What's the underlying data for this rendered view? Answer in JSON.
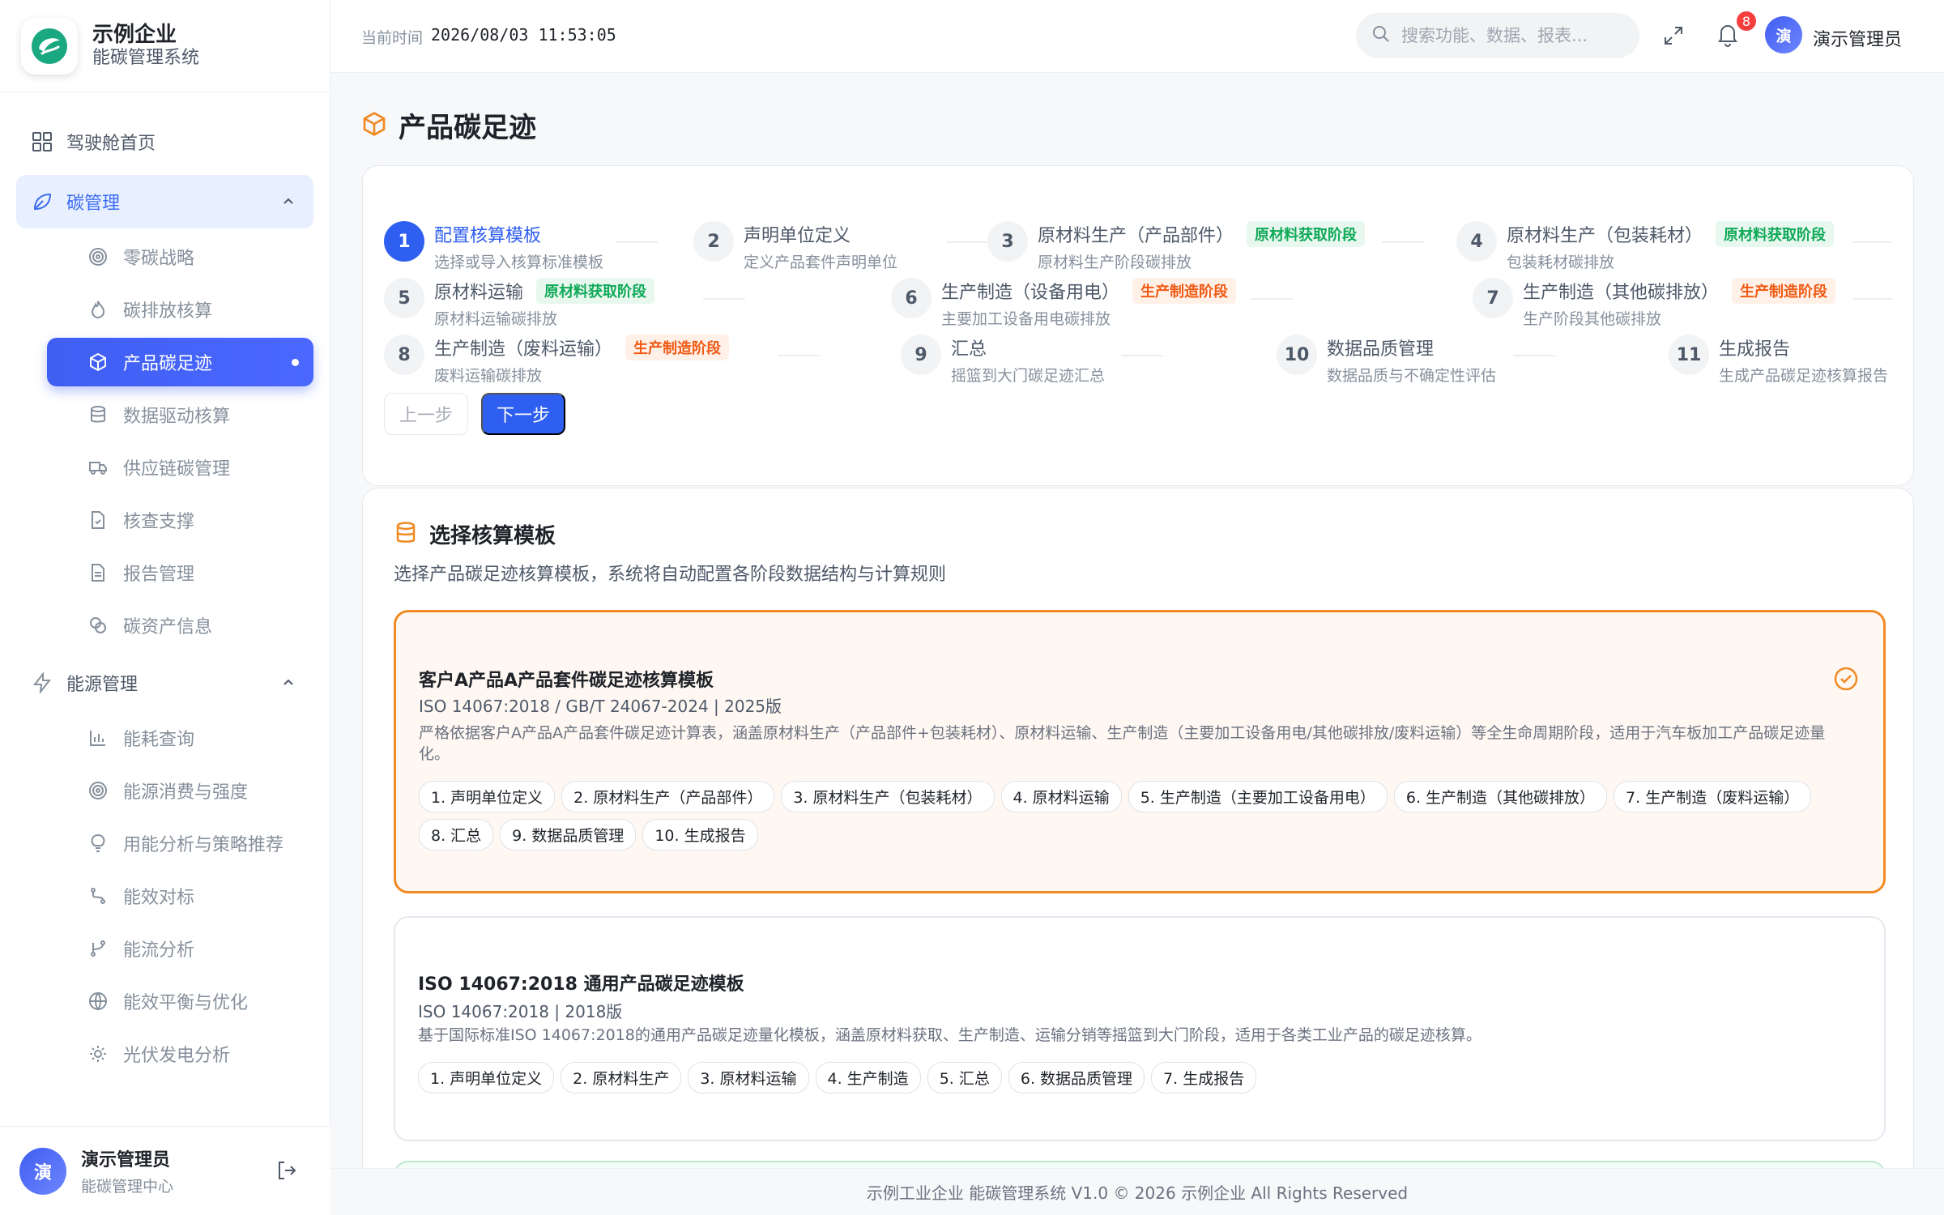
{
  "brand": {
    "name": "示例企业",
    "subtitle": "能碳管理系统"
  },
  "nav": {
    "home": "驾驶舱首页",
    "carbon_group": "碳管理",
    "carbon_items": [
      "零碳战略",
      "碳排放核算",
      "产品碳足迹",
      "数据驱动核算",
      "供应链碳管理",
      "核查支撑",
      "报告管理",
      "碳资产信息"
    ],
    "energy_group": "能源管理",
    "energy_items": [
      "能耗查询",
      "能源消费与强度",
      "用能分析与策略推荐",
      "能效对标",
      "能流分析",
      "能效平衡与优化",
      "光伏发电分析"
    ]
  },
  "user": {
    "avatar": "演",
    "name": "演示管理员",
    "role": "能碳管理中心"
  },
  "header": {
    "time_label": "当前时间",
    "time_value": "2026/08/03 11:53:05",
    "search_placeholder": "搜索功能、数据、报表...",
    "notification_count": "8",
    "user_name": "演示管理员"
  },
  "page": {
    "title": "产品碳足迹"
  },
  "steps": [
    {
      "num": "1",
      "title": "配置核算模板",
      "desc": "选择或导入核算标准模板",
      "tag": ""
    },
    {
      "num": "2",
      "title": "声明单位定义",
      "desc": "定义产品套件声明单位",
      "tag": ""
    },
    {
      "num": "3",
      "title": "原材料生产（产品部件）",
      "desc": "原材料生产阶段碳排放",
      "tag": "原材料获取阶段"
    },
    {
      "num": "4",
      "title": "原材料生产（包装耗材）",
      "desc": "包装耗材碳排放",
      "tag": "原材料获取阶段"
    },
    {
      "num": "5",
      "title": "原材料运输",
      "desc": "原材料运输碳排放",
      "tag": "原材料获取阶段"
    },
    {
      "num": "6",
      "title": "生产制造（设备用电）",
      "desc": "主要加工设备用电碳排放",
      "tag": "生产制造阶段"
    },
    {
      "num": "7",
      "title": "生产制造（其他碳排放）",
      "desc": "生产阶段其他碳排放",
      "tag": "生产制造阶段"
    },
    {
      "num": "8",
      "title": "生产制造（废料运输）",
      "desc": "废料运输碳排放",
      "tag": "生产制造阶段"
    },
    {
      "num": "9",
      "title": "汇总",
      "desc": "摇篮到大门碳足迹汇总",
      "tag": ""
    },
    {
      "num": "10",
      "title": "数据品质管理",
      "desc": "数据品质与不确定性评估",
      "tag": ""
    },
    {
      "num": "11",
      "title": "生成报告",
      "desc": "生成产品碳足迹核算报告",
      "tag": ""
    }
  ],
  "buttons": {
    "prev": "上一步",
    "next": "下一步"
  },
  "template_section": {
    "title": "选择核算模板",
    "desc": "选择产品碳足迹核算模板，系统将自动配置各阶段数据结构与计算规则"
  },
  "templates": [
    {
      "name": "客户A产品A产品套件碳足迹核算模板",
      "standard": "ISO 14067:2018 / GB/T 24067-2024 | 2025版",
      "desc": "严格依据客户A产品A产品套件碳足迹计算表，涵盖原材料生产（产品部件+包装耗材）、原材料运输、生产制造（主要加工设备用电/其他碳排放/废料运输）等全生命周期阶段，适用于汽车板加工产品碳足迹量化。",
      "chips": [
        "1. 声明单位定义",
        "2. 原材料生产（产品部件）",
        "3. 原材料生产（包装耗材）",
        "4. 原材料运输",
        "5. 生产制造（主要加工设备用电）",
        "6. 生产制造（其他碳排放）",
        "7. 生产制造（废料运输）",
        "8. 汇总",
        "9. 数据品质管理",
        "10. 生成报告"
      ]
    },
    {
      "name": "ISO 14067:2018 通用产品碳足迹模板",
      "standard": "ISO 14067:2018 | 2018版",
      "desc": "基于国际标准ISO 14067:2018的通用产品碳足迹量化模板，涵盖原材料获取、生产制造、运输分销等摇篮到大门阶段，适用于各类工业产品的碳足迹核算。",
      "chips": [
        "1. 声明单位定义",
        "2. 原材料生产",
        "3. 原材料运输",
        "4. 生产制造",
        "5. 汇总",
        "6. 数据品质管理",
        "7. 生成报告"
      ]
    }
  ],
  "footer": "示例工业企业 能碳管理系统 V1.0 © 2026 示例企业 All Rights Reserved",
  "colors": {
    "primary": "#2f5ff0",
    "accent_orange": "#f08a24",
    "tag_green": "#0fa958",
    "tag_red": "#f05a14"
  }
}
